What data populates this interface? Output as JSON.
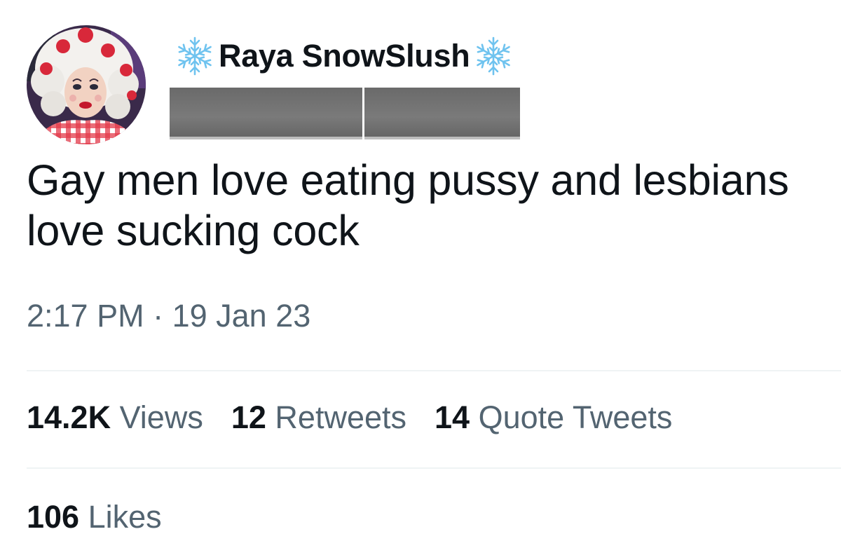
{
  "author": {
    "display_name": "Raya SnowSlush",
    "name_emoji_left": "snowflake-icon",
    "name_emoji_right": "snowflake-icon",
    "handle_redacted": true,
    "avatar": "drag-queen-avatar"
  },
  "tweet": {
    "text": "Gay men love eating pussy and lesbians love sucking cock",
    "time": "2:17 PM",
    "separator": " · ",
    "date": "19 Jan 23"
  },
  "stats": {
    "views_count": "14.2K",
    "views_label": "Views",
    "retweets_count": "12",
    "retweets_label": "Retweets",
    "quotes_count": "14",
    "quotes_label": "Quote Tweets",
    "likes_count": "106",
    "likes_label": "Likes"
  },
  "colors": {
    "text_primary": "#0f1419",
    "text_secondary": "#536471",
    "divider": "#eff3f4",
    "snowflake": "#6fc3ef",
    "redaction": "#6e6e6e"
  }
}
